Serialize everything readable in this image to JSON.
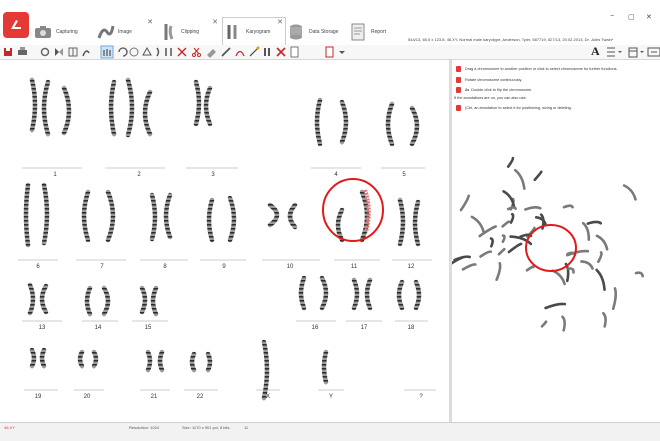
{
  "tabs": [
    {
      "label": "Capturing",
      "closable": false,
      "active": false
    },
    {
      "label": "Image",
      "closable": true,
      "active": false
    },
    {
      "label": "Clipping",
      "closable": true,
      "active": false
    },
    {
      "label": "Karyogram",
      "closable": true,
      "active": true
    },
    {
      "label": "Data Storage",
      "closable": false,
      "active": false
    },
    {
      "label": "Report",
      "closable": false,
      "active": false
    }
  ],
  "document_info": "544/13, 65.5 x 123.8, 46,XY, Normal male karyotype, Anderson, Tyler, 587719, 827/13, 20.02.2013, Dr. Jules Twain*",
  "text_tool_label": "A",
  "hints": {
    "drag": "Drag a chromosome to another position or click to select chromosome for further functions.",
    "rotate": "Rotate chromosome continuously.",
    "flip_prefix": "2x",
    "flip": "Double click to flip the chromosome.",
    "annotations_note": "If the annotations are on, you can also use:",
    "ctrl": "(Ctrl, an annotation to select it for positioning, sizing or deleting."
  },
  "karyogram": {
    "labels": [
      "1",
      "2",
      "3",
      "4",
      "5",
      "6",
      "7",
      "8",
      "9",
      "10",
      "11",
      "12",
      "13",
      "14",
      "15",
      "16",
      "17",
      "18",
      "19",
      "20",
      "21",
      "22",
      "X",
      "Y",
      "?"
    ]
  },
  "status": {
    "left": "46,XY",
    "resolution": "Resolution: 1024",
    "size": "Size: 1170 x 901 pxl, 8 bits",
    "count": "11"
  },
  "colors": {
    "accent": "#e53935",
    "highlight_circle": "#e01b1b"
  }
}
